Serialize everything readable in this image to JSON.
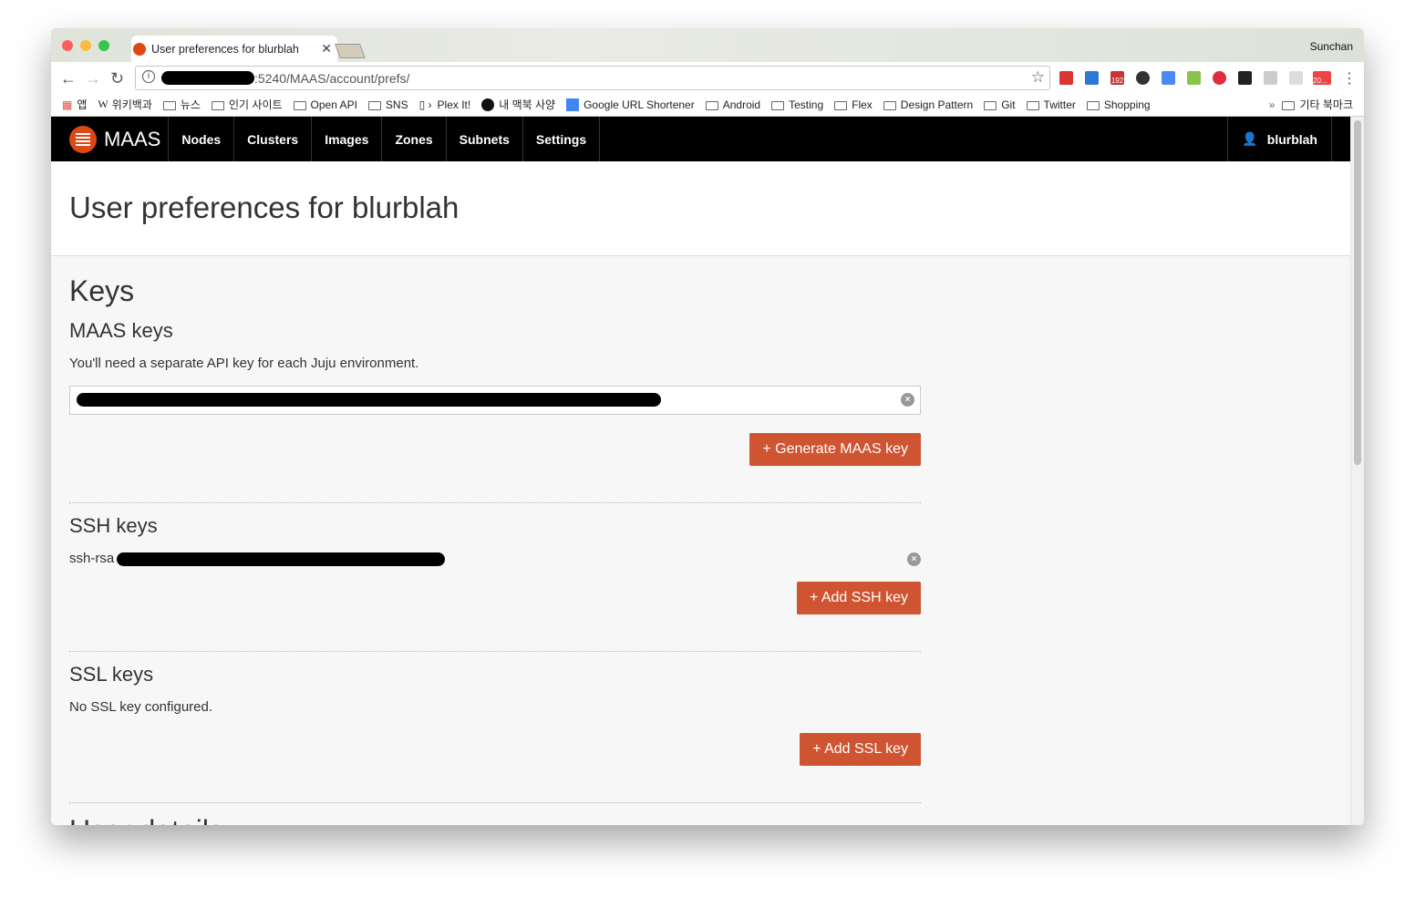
{
  "browser": {
    "tab_title": "User preferences for blurblah",
    "profile": "Sunchan",
    "url": ":5240/MAAS/account/prefs/",
    "bookmarks": [
      "앱",
      "위키백과",
      "뉴스",
      "인기 사이트",
      "Open API",
      "SNS",
      "Plex It!",
      "내 맥북 사양",
      "Google URL Shortener",
      "Android",
      "Testing",
      "Flex",
      "Design Pattern",
      "Git",
      "Twitter",
      "Shopping"
    ],
    "other_bookmarks": "기타 북마크",
    "overflow": "»",
    "badges": {
      "ext_count": "192",
      "mail_count": "20..."
    }
  },
  "nav": {
    "brand": "MAAS",
    "items": [
      "Nodes",
      "Clusters",
      "Images",
      "Zones",
      "Subnets",
      "Settings"
    ],
    "user": "blurblah"
  },
  "page": {
    "title": "User preferences for blurblah"
  },
  "keys": {
    "heading": "Keys",
    "maas": {
      "heading": "MAAS keys",
      "description": "You'll need a separate API key for each Juju environment.",
      "button": "+ Generate MAAS key"
    },
    "ssh": {
      "heading": "SSH keys",
      "prefix": "ssh-rsa",
      "button": "+ Add SSH key"
    },
    "ssl": {
      "heading": "SSL keys",
      "empty": "No SSL key configured.",
      "button": "+ Add SSL key"
    }
  },
  "user_details": {
    "heading": "User details"
  },
  "colors": {
    "accent": "#cf5431",
    "navbar": "#000000"
  }
}
